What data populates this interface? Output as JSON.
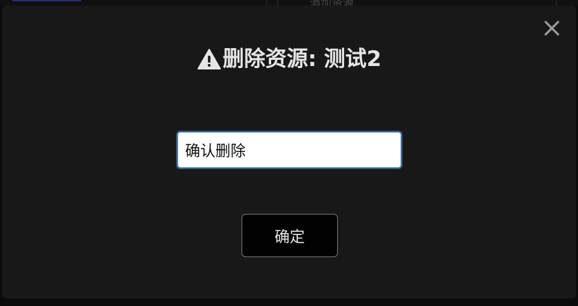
{
  "background": {
    "ghost_text": "添加资源"
  },
  "dialog": {
    "title": "删除资源: 测试2",
    "warning_icon": "warning-triangle-icon",
    "close_icon": "close-icon",
    "confirm_input": {
      "value": "确认删除",
      "placeholder": ""
    },
    "confirm_button_label": "确定"
  },
  "colors": {
    "modal_bg": "#181818",
    "title_text": "#e6e6e6",
    "button_bg": "#020202",
    "input_focus": "#7aa7d6"
  }
}
